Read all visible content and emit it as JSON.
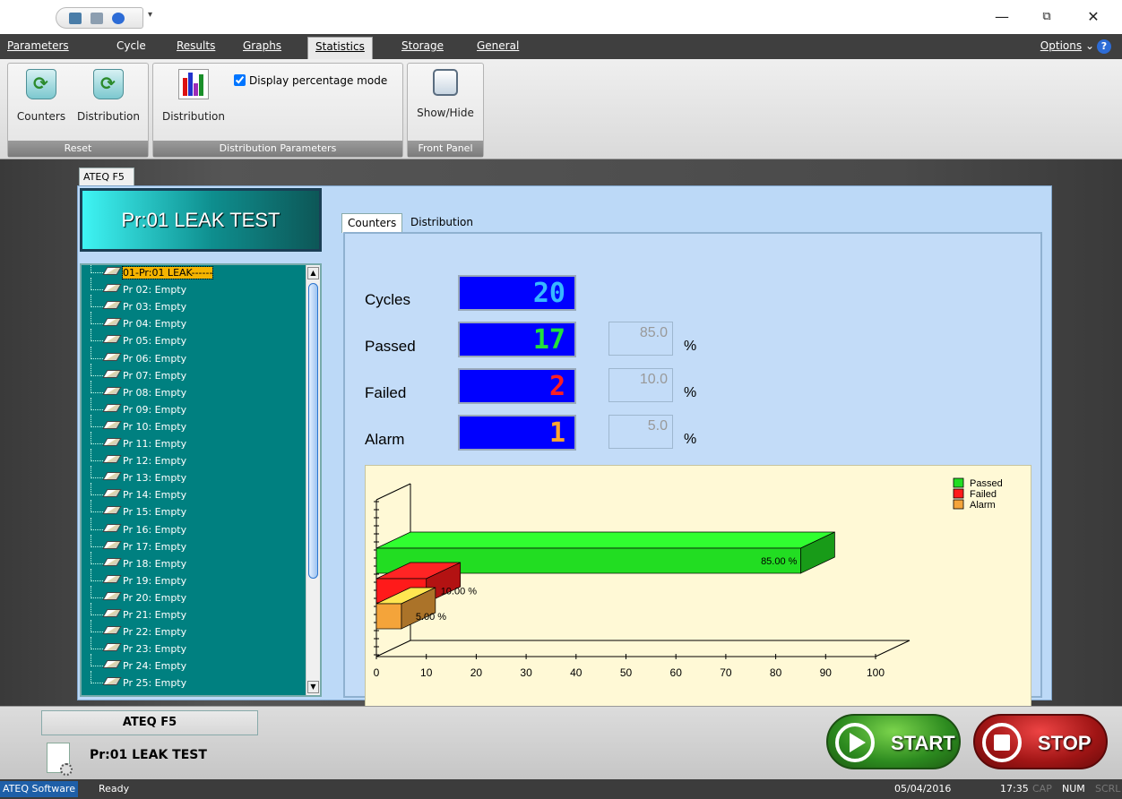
{
  "window": {
    "minimize": "—",
    "restore": "⧉",
    "close": "✕"
  },
  "menu": {
    "items": [
      "Parameters",
      "Cycle",
      "Results",
      "Graphs",
      "Statistics",
      "Storage",
      "General"
    ],
    "options": "Options"
  },
  "ribbon": {
    "reset_group": {
      "label": "Reset",
      "counters": "Counters",
      "distribution": "Distribution"
    },
    "dist_group": {
      "label": "Distribution Parameters",
      "distribution": "Distribution",
      "percentage_mode": "Display percentage mode",
      "percentage_checked": true
    },
    "front_group": {
      "label": "Front Panel",
      "showhide": "Show/Hide"
    }
  },
  "device_tab": "ATEQ F5",
  "program_title": "Pr:01  LEAK TEST",
  "programs": [
    "01-Pr:01 LEAK------",
    "Pr 02: Empty",
    "Pr 03: Empty",
    "Pr 04: Empty",
    "Pr 05: Empty",
    "Pr 06: Empty",
    "Pr 07: Empty",
    "Pr 08: Empty",
    "Pr 09: Empty",
    "Pr 10: Empty",
    "Pr 11: Empty",
    "Pr 12: Empty",
    "Pr 13: Empty",
    "Pr 14: Empty",
    "Pr 15: Empty",
    "Pr 16: Empty",
    "Pr 17: Empty",
    "Pr 18: Empty",
    "Pr 19: Empty",
    "Pr 20: Empty",
    "Pr 21: Empty",
    "Pr 22: Empty",
    "Pr 23: Empty",
    "Pr 24: Empty",
    "Pr 25: Empty"
  ],
  "tabs": {
    "counters": "Counters",
    "distribution": "Distribution"
  },
  "counters": {
    "cycles": {
      "label": "Cycles",
      "value": "20",
      "color": "#37b8ff"
    },
    "passed": {
      "label": "Passed",
      "value": "17",
      "pct": "85.0",
      "color": "#22e03a"
    },
    "failed": {
      "label": "Failed",
      "value": "2",
      "pct": "10.0",
      "color": "#ff1f1f"
    },
    "alarm": {
      "label": "Alarm",
      "value": "1",
      "pct": "5.0",
      "color": "#ffa52f"
    },
    "pct_unit": "%"
  },
  "chart_data": {
    "type": "bar",
    "orientation": "horizontal",
    "series": [
      {
        "name": "Passed",
        "value": 85.0,
        "label": "85.00 %",
        "color": "#22dd22"
      },
      {
        "name": "Failed",
        "value": 10.0,
        "label": "10.00 %",
        "color": "#ff1a1a"
      },
      {
        "name": "Alarm",
        "value": 5.0,
        "label": "5.00 %",
        "color": "#f4a43a"
      }
    ],
    "xlim": [
      0,
      100
    ],
    "xticks": [
      0,
      10,
      20,
      30,
      40,
      50,
      60,
      70,
      80,
      90,
      100
    ],
    "legend": "top-right"
  },
  "bottom": {
    "device": "ATEQ F5",
    "program": "Pr:01  LEAK TEST",
    "start": "START",
    "stop": "STOP"
  },
  "status": {
    "app": "ATEQ Software",
    "message": "Ready",
    "date": "05/04/2016",
    "time": "17:35",
    "cap": "CAP",
    "num": "NUM",
    "scrl": "SCRL"
  }
}
